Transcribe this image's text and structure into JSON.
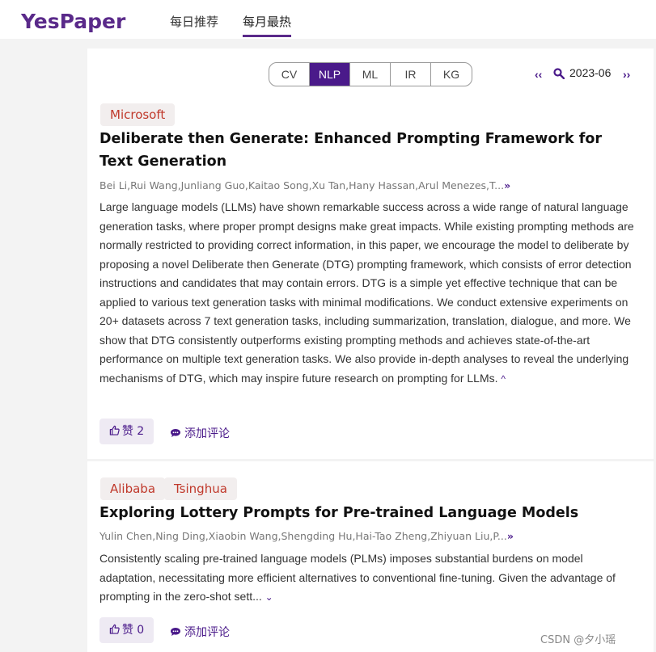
{
  "brand": "YesPaper",
  "nav": {
    "daily": "每日推荐",
    "monthly": "每月最热"
  },
  "categories": [
    "CV",
    "NLP",
    "ML",
    "IR",
    "KG"
  ],
  "selected_category": "NLP",
  "date": {
    "prev": "‹‹",
    "value": "2023-06",
    "next": "››"
  },
  "papers": [
    {
      "orgs": [
        "Microsoft"
      ],
      "title": "Deliberate then Generate: Enhanced Prompting Framework for Text Generation",
      "authors": "Bei Li,Rui Wang,Junliang Guo,Kaitao Song,Xu Tan,Hany Hassan,Arul Menezes,T...",
      "authors_more": "»",
      "abstract": "Large language models (LLMs) have shown remarkable success across a wide range of natural language generation tasks, where proper prompt designs make great impacts. While existing prompting methods are normally restricted to providing correct information, in this paper, we encourage the model to deliberate by proposing a novel Deliberate then Generate (DTG) prompting framework, which consists of error detection instructions and candidates that may contain errors. DTG is a simple yet effective technique that can be applied to various text generation tasks with minimal modifications. We conduct extensive experiments on 20+ datasets across 7 text generation tasks, including summarization, translation, dialogue, and more. We show that DTG consistently outperforms existing prompting methods and achieves state-of-the-art performance on multiple text generation tasks. We also provide in-depth analyses to reveal the underlying mechanisms of DTG, which may inspire future research on prompting for LLMs.",
      "abstract_toggle": "^",
      "like_label": "赞 2",
      "comment_label": "添加评论"
    },
    {
      "orgs": [
        "Alibaba",
        "Tsinghua"
      ],
      "title": "Exploring Lottery Prompts for Pre-trained Language Models",
      "authors": "Yulin Chen,Ning Ding,Xiaobin Wang,Shengding Hu,Hai-Tao Zheng,Zhiyuan Liu,P...",
      "authors_more": "»",
      "abstract": "Consistently scaling pre-trained language models (PLMs) imposes substantial burdens on model adaptation, necessitating more efficient alternatives to conventional fine-tuning. Given the advantage of prompting in the zero-shot sett...",
      "abstract_toggle": "⌄",
      "like_label": "赞 0",
      "comment_label": "添加评论"
    }
  ],
  "watermark": "CSDN @夕小瑶",
  "colors": {
    "brand": "#5a2a8a",
    "accent": "#4a1a8a",
    "tag_text": "#c0392b",
    "tag_bg": "#f2eeee"
  }
}
